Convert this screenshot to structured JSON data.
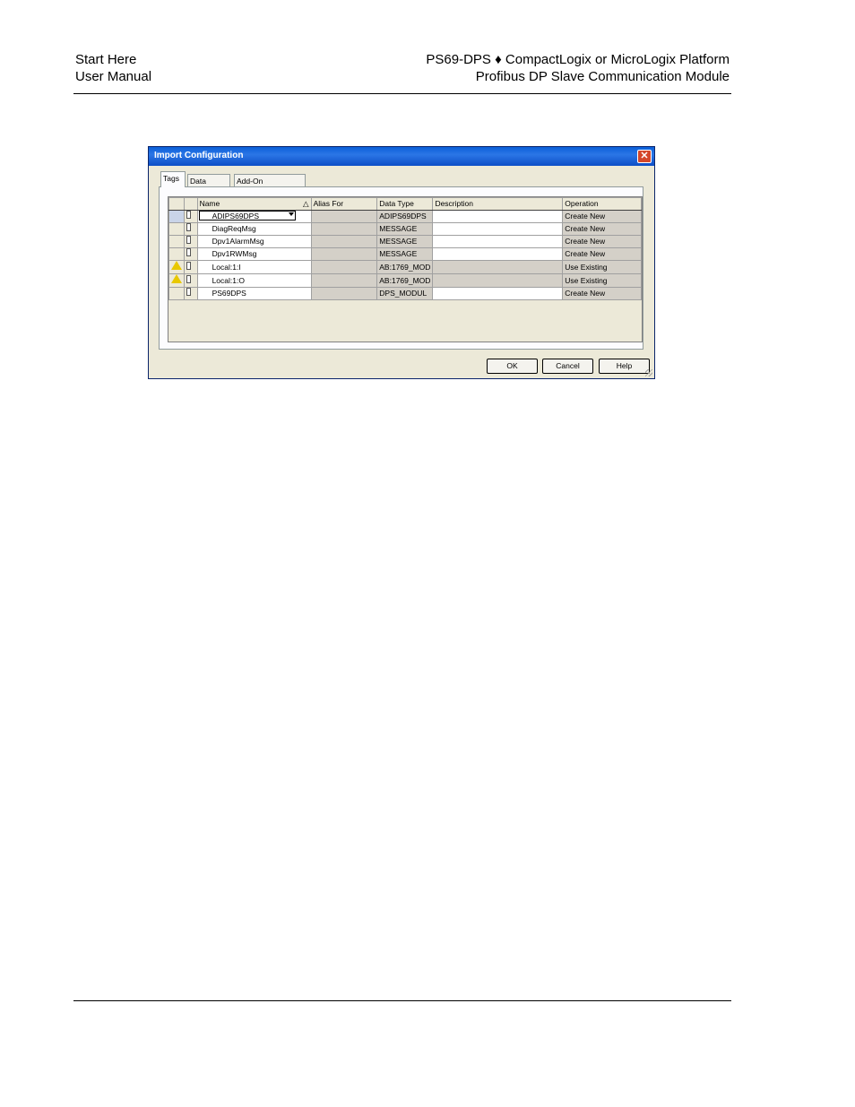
{
  "header": {
    "left_line1": "Start Here",
    "left_line2": "User Manual",
    "right_line1": "PS69-DPS ♦ CompactLogix or MicroLogix Platform",
    "right_line2": "Profibus DP Slave Communication Module"
  },
  "dialog": {
    "title": "Import Configuration",
    "close_glyph": "✕",
    "tabs": [
      "Tags",
      "Data Types",
      "Add-On Instructions"
    ],
    "columns": [
      "",
      "",
      "Name",
      "Alias For",
      "Data Type",
      "Description",
      "Operation"
    ],
    "sort_glyph": "△",
    "rows": [
      {
        "warn": false,
        "name": "ADIPS69DPS",
        "alias": "",
        "type": "ADIPS69DPS",
        "desc": "",
        "op": "Create New"
      },
      {
        "warn": false,
        "name": "DiagReqMsg",
        "alias": "",
        "type": "MESSAGE",
        "desc": "",
        "op": "Create New"
      },
      {
        "warn": false,
        "name": "Dpv1AlarmMsg",
        "alias": "",
        "type": "MESSAGE",
        "desc": "",
        "op": "Create New"
      },
      {
        "warn": false,
        "name": "Dpv1RWMsg",
        "alias": "",
        "type": "MESSAGE",
        "desc": "",
        "op": "Create New"
      },
      {
        "warn": true,
        "name": "Local:1:I",
        "alias": "",
        "type": "AB:1769_MOD",
        "desc": "",
        "op": "Use Existing"
      },
      {
        "warn": true,
        "name": "Local:1:O",
        "alias": "",
        "type": "AB:1769_MOD",
        "desc": "",
        "op": "Use Existing"
      },
      {
        "warn": false,
        "name": "PS69DPS",
        "alias": "",
        "type": "DPS_MODUL",
        "desc": "",
        "op": "Create New"
      }
    ],
    "buttons": {
      "ok": "OK",
      "cancel": "Cancel",
      "help": "Help"
    }
  }
}
